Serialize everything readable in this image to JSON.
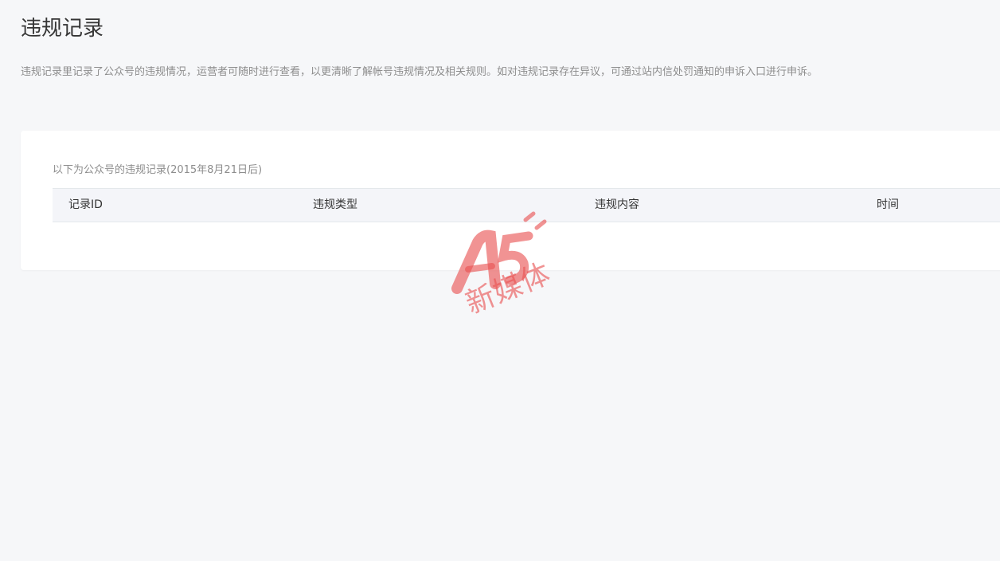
{
  "page": {
    "title": "违规记录",
    "description": "违规记录里记录了公众号的违规情况，运营者可随时进行查看，以更清晰了解帐号违规情况及相关规则。如对违规记录存在异议，可通过站内信处罚通知的申诉入口进行申诉。"
  },
  "card": {
    "caption": "以下为公众号的违规记录(2015年8月21日后)",
    "table": {
      "columns": [
        "记录ID",
        "违规类型",
        "违规内容",
        "时间"
      ],
      "rows": []
    }
  },
  "watermark": {
    "logo": "A5",
    "text": "新媒体",
    "color": "#e85050"
  }
}
